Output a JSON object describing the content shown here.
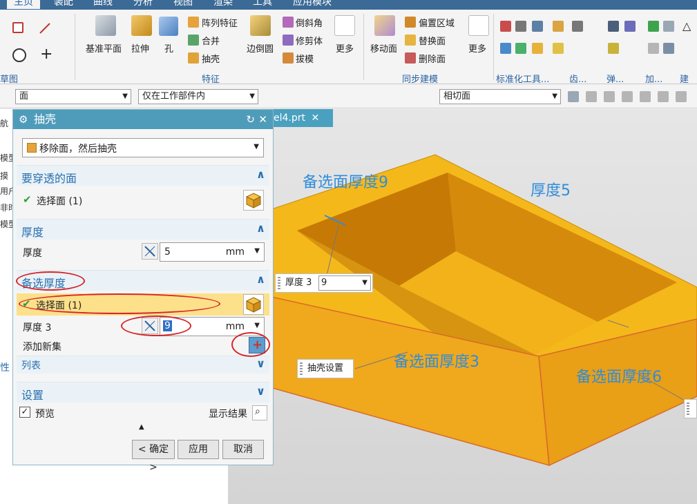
{
  "menu_tabs": [
    "主页",
    "装配",
    "曲线",
    "分析",
    "视图",
    "渲染",
    "工具",
    "应用模块"
  ],
  "ribbon": {
    "sketch_group": "草图",
    "feature_group": "特征",
    "sync_group": "同步建模",
    "more_groups": [
      "标准化工具...",
      "齿...",
      "弹...",
      "加...",
      "建模"
    ],
    "datum_plane": "基准平面",
    "extrude": "拉伸",
    "hole": "孔",
    "pattern": "阵列特征",
    "unite": "合并",
    "shell": "抽壳",
    "edge_blend": "边倒圆",
    "chamfer": "倒斜角",
    "trim_body": "修剪体",
    "draft": "拔模",
    "more": "更多",
    "move_face": "移动面",
    "offset_region": "偏置区域",
    "replace_face": "替换面",
    "delete_face": "删除面",
    "more2": "更多"
  },
  "selection_bar": {
    "filter": "面",
    "scope": "仅在工作部件内",
    "snap": "相切面"
  },
  "nav_fragments": [
    "航",
    "模型",
    "摸",
    "用户",
    "非时",
    "模型",
    "性"
  ],
  "tab_file": "el4.prt",
  "dialog": {
    "title": "抽壳",
    "type": "移除面，然后抽壳",
    "pierce_section": "要穿透的面",
    "select_face": "选择面 (1)",
    "thickness_section": "厚度",
    "thickness_label": "厚度",
    "thickness_value": "5",
    "unit": "mm",
    "alt_section": "备选厚度",
    "alt_select": "选择面 (1)",
    "thickness3_label": "厚度 3",
    "thickness3_value": "9",
    "add_set": "添加新集",
    "list": "列表",
    "settings": "设置",
    "preview": "预览",
    "show_result": "显示结果",
    "ok": "< 确定 >",
    "apply": "应用",
    "cancel": "取消"
  },
  "viewport": {
    "callout_alt9": "备选面厚度9",
    "callout_thk5": "厚度5",
    "callout_alt3": "备选面厚度3",
    "callout_alt6": "备选面厚度6",
    "flag_label": "厚度 3",
    "flag_value": "9",
    "shell_settings": "抽壳设置"
  }
}
